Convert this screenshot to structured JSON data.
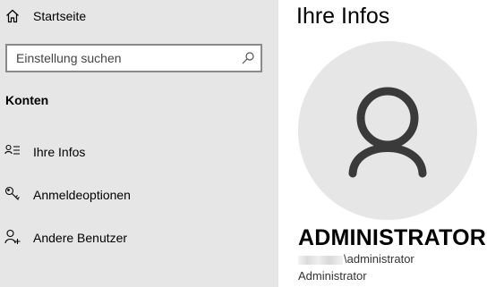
{
  "sidebar": {
    "home": {
      "label": "Startseite",
      "icon": "home-icon"
    },
    "search": {
      "placeholder": "Einstellung suchen",
      "icon": "search-icon"
    },
    "section_title": "Konten",
    "items": [
      {
        "label": "Ihre Infos",
        "icon": "user-info-icon",
        "selected": true
      },
      {
        "label": "Anmeldeoptionen",
        "icon": "key-icon",
        "selected": false
      },
      {
        "label": "Andere Benutzer",
        "icon": "add-user-icon",
        "selected": false
      }
    ]
  },
  "main": {
    "title": "Ihre Infos",
    "user": {
      "name": "ADMINISTRATOR",
      "account": "\\administrator",
      "role": "Administrator"
    }
  },
  "colors": {
    "sidebar_bg": "#e6e6e6",
    "avatar_bg": "#e6e6e6",
    "avatar_glyph": "#3a3a3a",
    "content_bg": "#ffffff"
  }
}
